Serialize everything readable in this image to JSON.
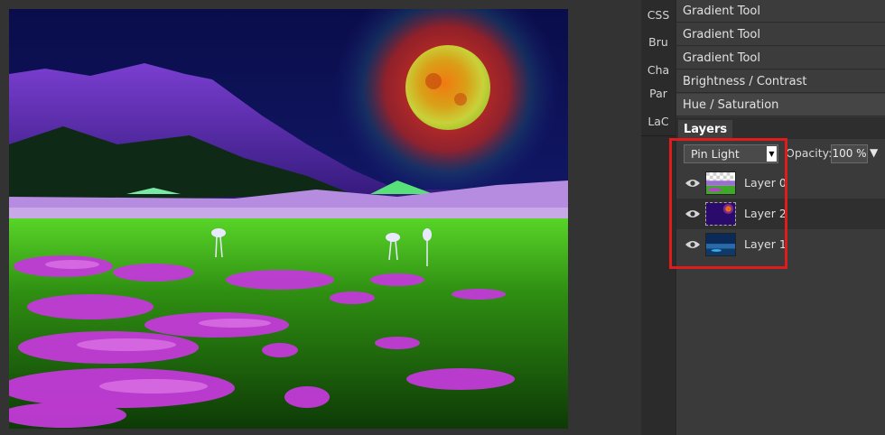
{
  "side_tabs": [
    "CSS",
    "Bru",
    "Cha",
    "Par",
    "LaC"
  ],
  "history": {
    "items": [
      "Gradient Tool",
      "Gradient Tool",
      "Gradient Tool",
      "Brightness / Contrast",
      "Hue / Saturation"
    ]
  },
  "layers": {
    "tab_label": "Layers",
    "blend_mode": "Pin Light",
    "opacity_label": "Opacity:",
    "opacity_value": "100 %",
    "items": [
      {
        "name": "Layer 0",
        "visible": true,
        "thumbnail": "landscape-transparent"
      },
      {
        "name": "Layer 2",
        "visible": true,
        "thumbnail": "purple-moon",
        "selected": true
      },
      {
        "name": "Layer 1",
        "visible": true,
        "thumbnail": "blue-scene"
      }
    ]
  },
  "icons": {
    "visibility": "eye-icon",
    "dropdown": "triangle-down-icon"
  },
  "colors": {
    "highlight": "#e01b1b",
    "panel_bg": "#3a3a3a",
    "canvas_bg": "#333333"
  }
}
